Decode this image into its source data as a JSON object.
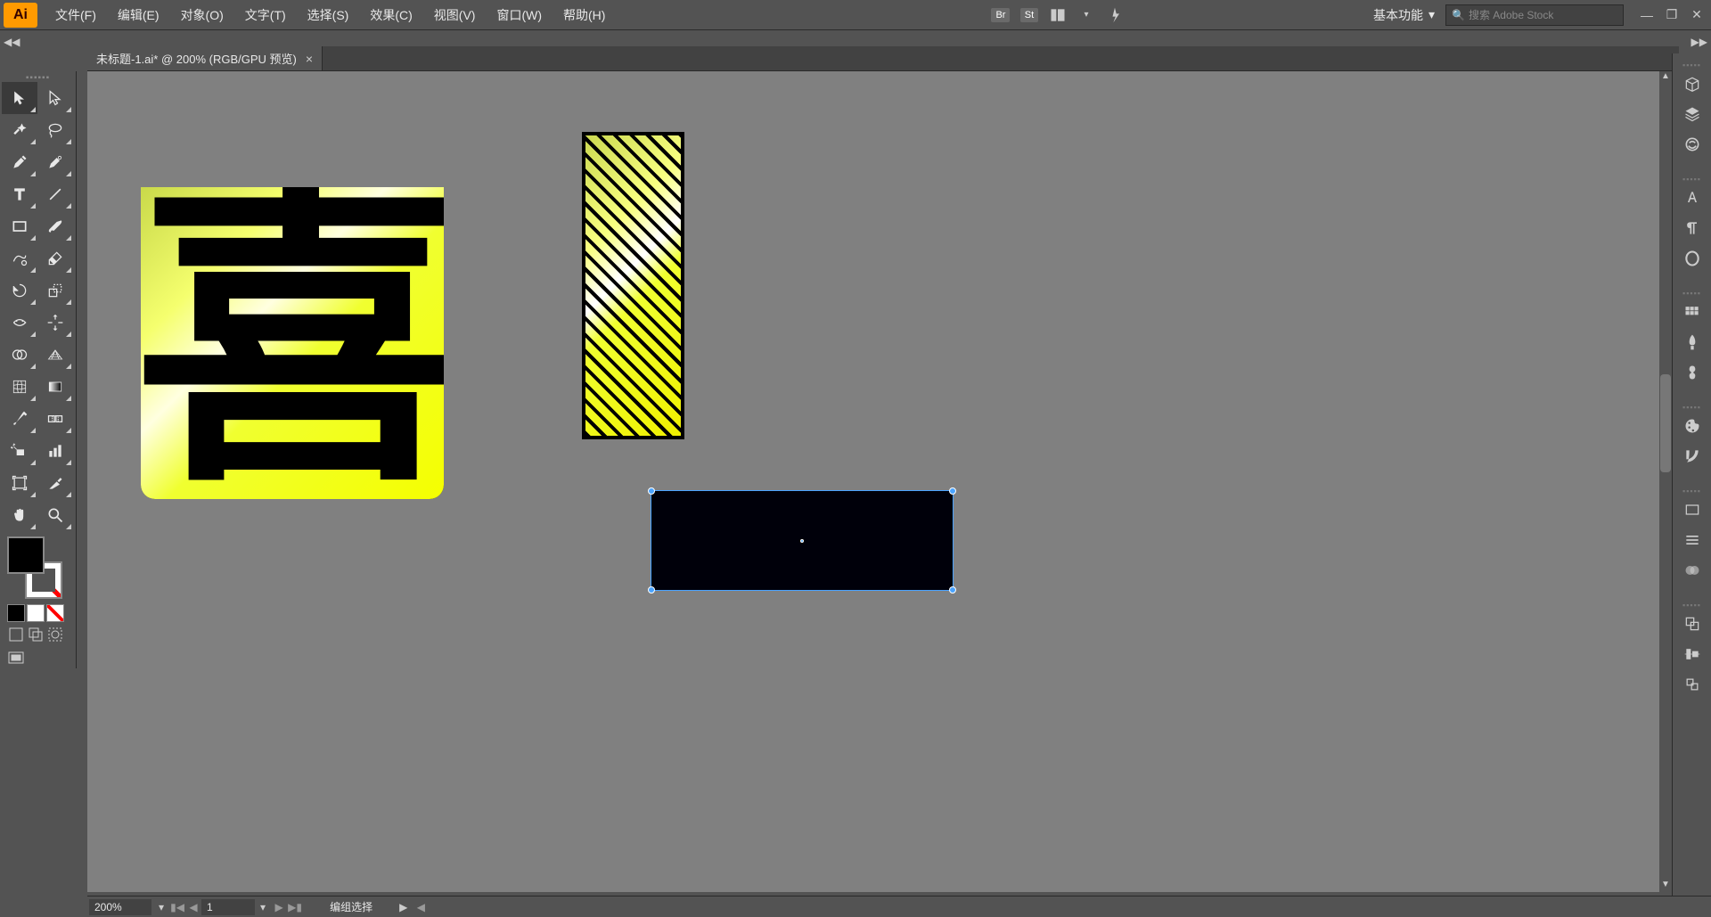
{
  "app": {
    "logo": "Ai"
  },
  "menu": {
    "file": "文件(F)",
    "edit": "编辑(E)",
    "object": "对象(O)",
    "type": "文字(T)",
    "select": "选择(S)",
    "effect": "效果(C)",
    "view": "视图(V)",
    "window": "窗口(W)",
    "help": "帮助(H)"
  },
  "topbar": {
    "br": "Br",
    "st": "St",
    "workspace": "基本功能",
    "search_placeholder": "搜索 Adobe Stock"
  },
  "tab": {
    "title": "未标题-1.ai* @ 200% (RGB/GPU 预览)"
  },
  "status": {
    "zoom": "200%",
    "page": "1",
    "selection": "编组选择"
  },
  "canvas": {
    "char": "喜"
  }
}
